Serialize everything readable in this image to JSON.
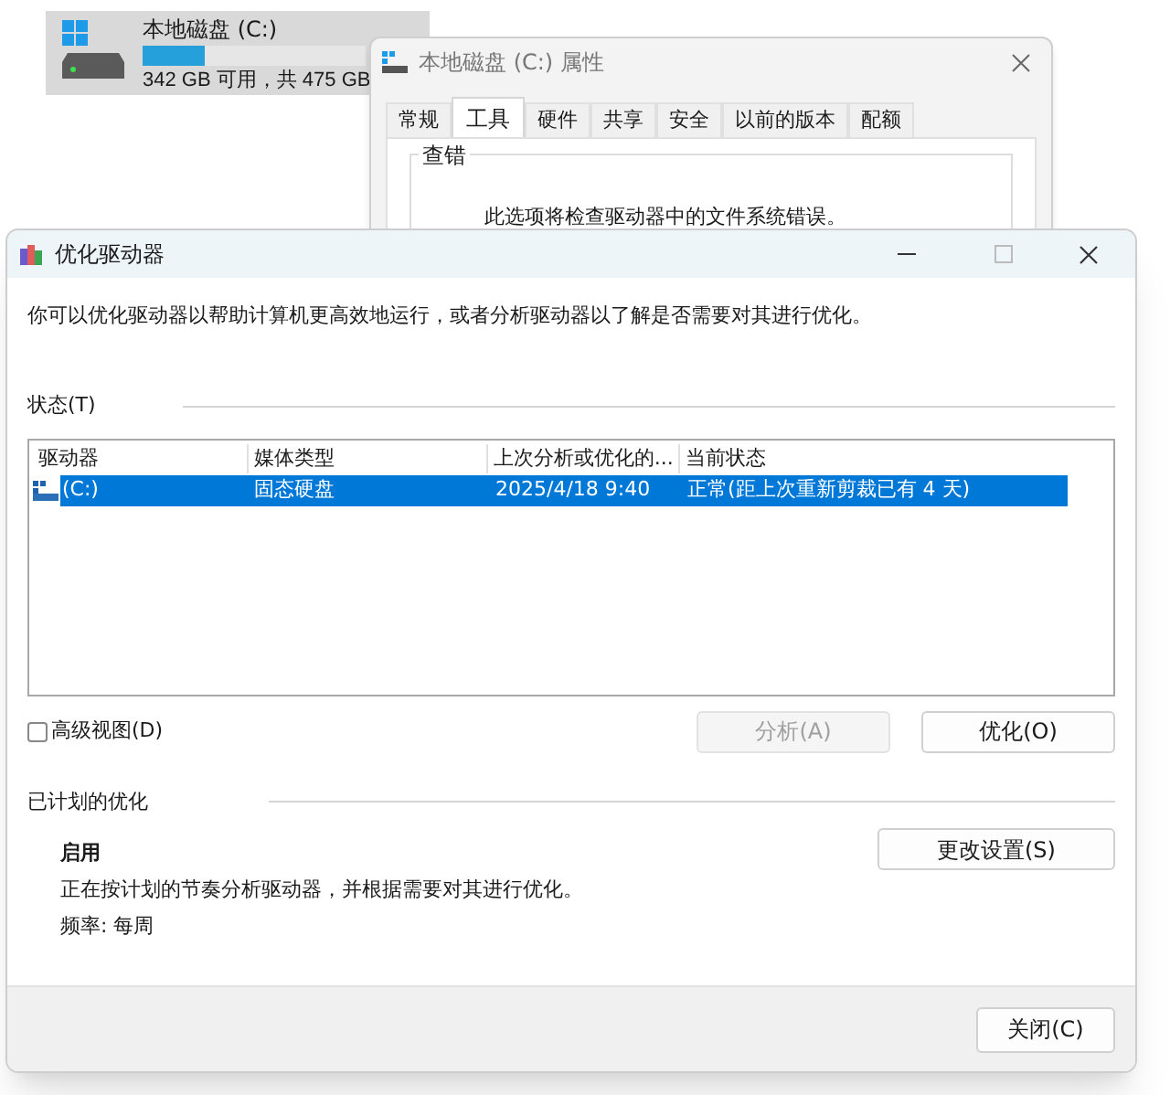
{
  "drive_tile": {
    "name": "本地磁盘 (C:)",
    "level": 0.28,
    "space": "342 GB 可用，共 475 GB"
  },
  "properties_window": {
    "title": "本地磁盘 (C:) 属性",
    "tabs": [
      {
        "label": "常规",
        "selected": false
      },
      {
        "label": "工具",
        "selected": true
      },
      {
        "label": "硬件",
        "selected": false
      },
      {
        "label": "共享",
        "selected": false
      },
      {
        "label": "安全",
        "selected": false
      },
      {
        "label": "以前的版本",
        "selected": false
      },
      {
        "label": "配额",
        "selected": false
      }
    ],
    "group_title": "查错",
    "description": "此选项将检查驱动器中的文件系统错误。"
  },
  "dialog": {
    "title": "优化驱动器",
    "intro": "你可以优化驱动器以帮助计算机更高效地运行，或者分析驱动器以了解是否需要对其进行优化。",
    "status_label": "状态(T)",
    "table": {
      "columns": [
        "驱动器",
        "媒体类型",
        "上次分析或优化的...",
        "当前状态"
      ],
      "rows": [
        {
          "cells": [
            "(C:)",
            "固态硬盘",
            "2025/4/18 9:40",
            "正常(距上次重新剪裁已有 4 天)"
          ],
          "selected": true
        }
      ]
    },
    "advanced_view": {
      "label": "高级视图(D)",
      "checked": false
    },
    "buttons": [
      {
        "label": "分析(A)",
        "disabled": true
      },
      {
        "label": "优化(O)",
        "disabled": false
      }
    ],
    "scheduled": {
      "heading": "已计划的优化",
      "state": "启用",
      "description": "正在按计划的节奏分析驱动器，并根据需要对其进行优化。",
      "frequency": "频率: 每周",
      "button": "更改设置(S)"
    },
    "close_button": "关闭(C)"
  }
}
